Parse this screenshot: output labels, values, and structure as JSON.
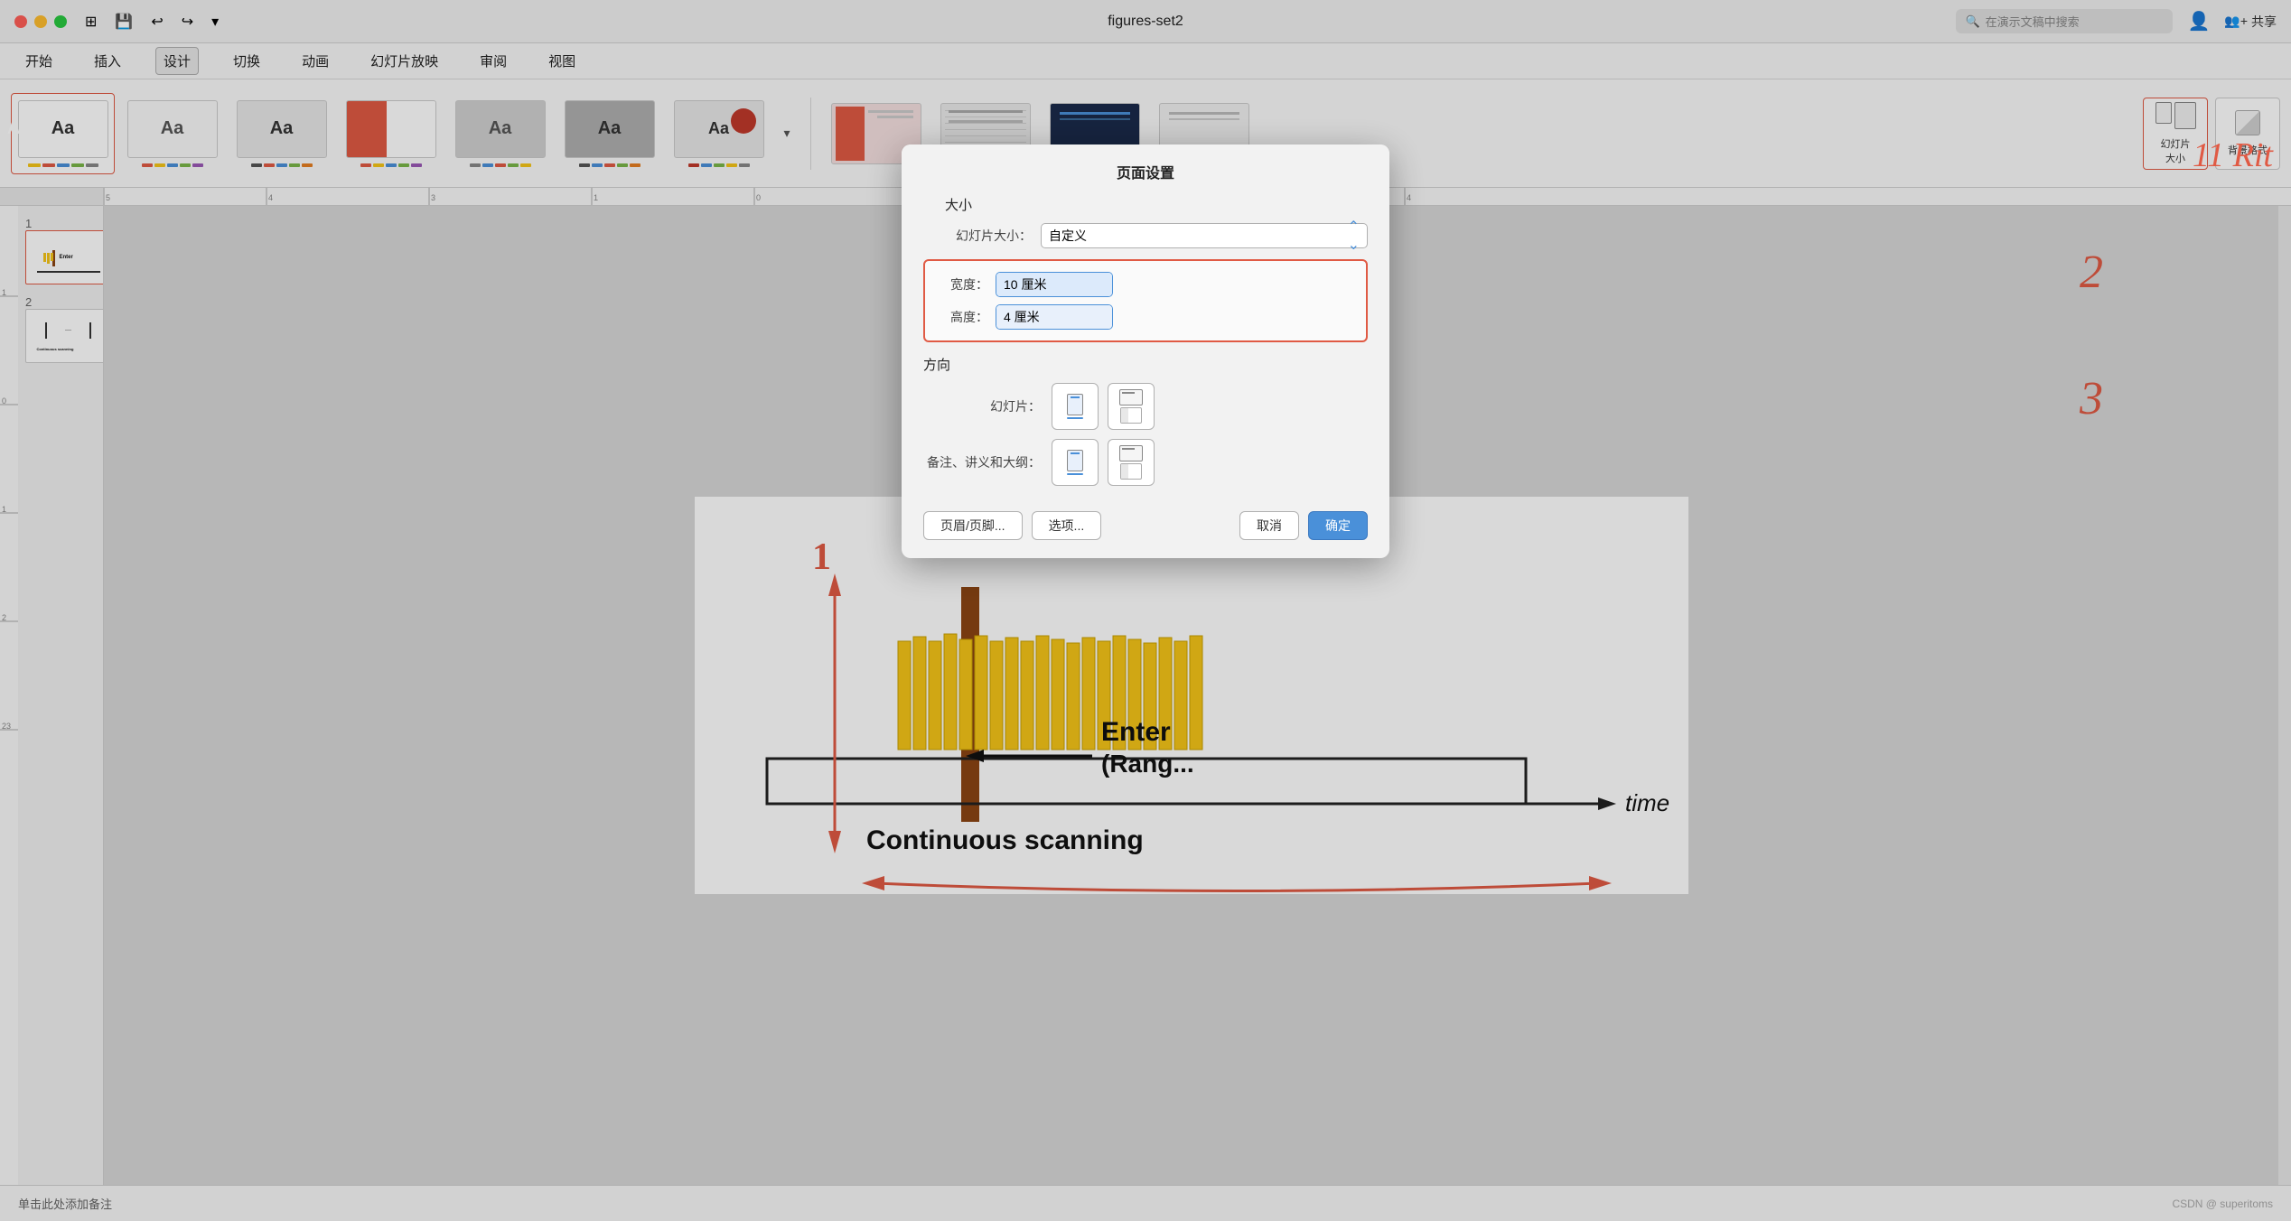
{
  "app": {
    "title": "figures-set2",
    "window_controls": [
      "close",
      "minimize",
      "maximize"
    ],
    "toolbar_icons": [
      "grid",
      "save",
      "undo",
      "redo",
      "more"
    ]
  },
  "menubar": {
    "items": [
      "开始",
      "插入",
      "设计",
      "切换",
      "动画",
      "幻灯片放映",
      "审阅",
      "视图"
    ],
    "active": "设计"
  },
  "ribbon": {
    "themes": [
      {
        "label": "Aa",
        "selected": true,
        "style": "plain"
      },
      {
        "label": "Aa",
        "selected": false,
        "style": "plain2"
      },
      {
        "label": "Aa",
        "selected": false,
        "style": "colored"
      },
      {
        "label": "Aa",
        "selected": false,
        "style": "red"
      },
      {
        "label": "Aa",
        "selected": false,
        "style": "gray"
      },
      {
        "label": "Aa",
        "selected": false,
        "style": "dark"
      },
      {
        "label": "Aa",
        "selected": false,
        "style": "light"
      }
    ],
    "layouts": [
      {
        "style": "red-accent"
      },
      {
        "style": "lines"
      },
      {
        "style": "dark-blue"
      },
      {
        "style": "minimal"
      }
    ],
    "right_buttons": [
      {
        "label": "幻灯片\n大小",
        "icon": "slidesize"
      },
      {
        "label": "背景格式",
        "icon": "bgformat"
      }
    ]
  },
  "slides": [
    {
      "number": 1,
      "active": true
    },
    {
      "number": 2,
      "active": false
    }
  ],
  "slide_content": {
    "enter_text": "Enter",
    "range_text": "(Rang",
    "scanning_text": "Continuous scanning",
    "time_label": "time",
    "arrow_label": "←"
  },
  "dialog": {
    "title": "页面设置",
    "size_section": "大小",
    "slide_size_label": "幻灯片大小：",
    "slide_size_value": "自定义",
    "width_label": "宽度：",
    "width_value": "10 厘米",
    "height_label": "高度：",
    "height_value": "4 厘米",
    "orientation_section": "方向",
    "slide_label": "幻灯片：",
    "notes_label": "备注、讲义和大纲：",
    "buttons": {
      "header_footer": "页眉/页脚...",
      "options": "选项...",
      "cancel": "取消",
      "ok": "确定"
    }
  },
  "statusbar": {
    "hint": "单击此处添加备注",
    "version": "CSDN @ superitoms"
  },
  "search": {
    "placeholder": "在演示文稿中搜索"
  },
  "annotations": {
    "number1": "1",
    "number2": "2",
    "number3": "3",
    "number4": "11 Rit"
  }
}
